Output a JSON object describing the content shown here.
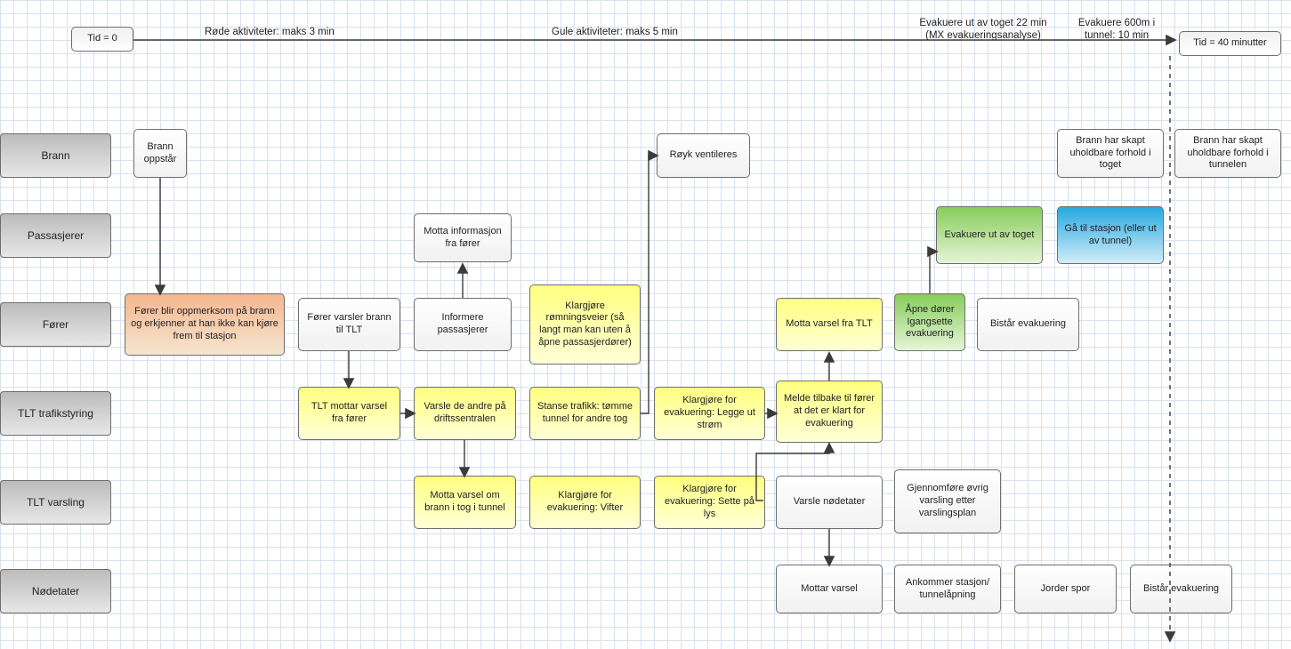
{
  "timeline": {
    "t0": "Tid = 0",
    "red": "Røde aktiviteter: maks 3 min",
    "yellow": "Gule aktiviteter: maks 5 min",
    "evac_train": "Evakuere ut av toget 22 min (MX evakueringsanalyse)",
    "evac_tunnel": "Evakuere 600m i tunnel: 10 min",
    "t40": "Tid = 40 minutter"
  },
  "lanes": {
    "brann": "Brann",
    "passasjerer": "Passasjerer",
    "forer": "Fører",
    "tlt_traf": "TLT trafikstyring",
    "tlt_vars": "TLT varsling",
    "nodetater": "Nødetater"
  },
  "n": {
    "brann_oppstar": "Brann oppstår",
    "royk_vent": "Røyk ventileres",
    "brann_tog": "Brann har skapt uholdbare forhold i toget",
    "brann_tunnel": "Brann har skapt uholdbare forhold i tunnelen",
    "motta_info": "Motta informasjon fra fører",
    "evak_ut": "Evakuere ut av toget",
    "ga_stasjon": "Gå til stasjon (eller ut av tunnel)",
    "forer_oppmerk": "Fører blir oppmerksom på brann og erkjenner at han ikke kan kjøre frem til stasjon",
    "forer_varsler": "Fører varsler brann til TLT",
    "informere_pass": "Informere passasjerer",
    "klargjore_romn": "Klargjøre rømningsveier (så langt man kan uten å åpne passasjerdører)",
    "motta_varsel_tlt": "Motta varsel fra TLT",
    "apne_dorer": "Åpne dører Igangsette evakuering",
    "bistar_evak_forer": "Bistår evakuering",
    "tlt_mottar": "TLT mottar varsel fra fører",
    "varsle_andre": "Varsle de andre på driftssentralen",
    "stanse_trafikk": "Stanse trafikk: tømme tunnel for andre tog",
    "klargjore_strom": "Klargjøre for evakuering: Legge ut strøm",
    "melde_tilbake": "Melde tilbake til fører at det er klart for evakuering",
    "motta_varsel_brann": "Motta varsel om brann i tog i tunnel",
    "klargjore_vifter": "Klargjøre for evakuering: Vifter",
    "klargjore_lys": "Klargjøre for evakuering: Sette på lys",
    "varsle_nodetater": "Varsle nødetater",
    "gjennomfore_varsling": "Gjennomføre øvrig varsling etter varslingsplan",
    "mottar_varsel": "Mottar varsel",
    "ankommer_stasjon": "Ankommer stasjon/ tunnelåpning",
    "jorder_spor": "Jorder spor",
    "bistar_evak_nod": "Bistår evakuering"
  }
}
